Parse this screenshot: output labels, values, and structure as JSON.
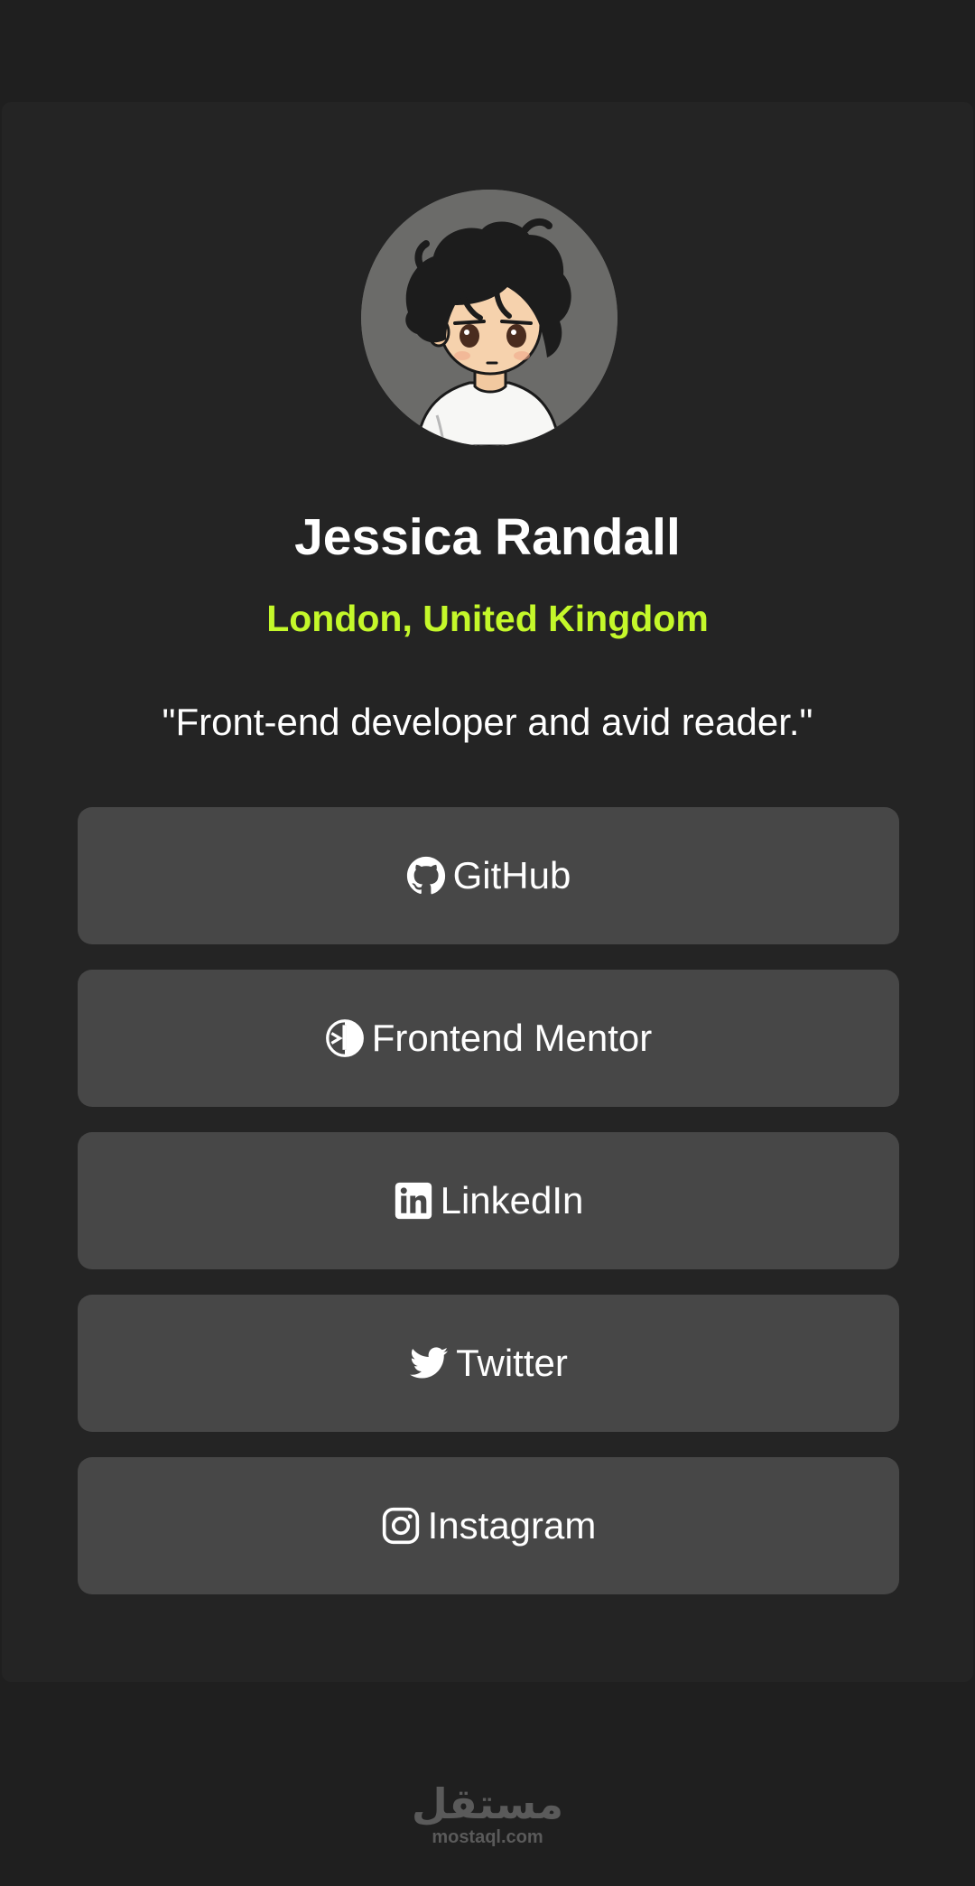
{
  "profile": {
    "name": "Jessica Randall",
    "location": "London, United Kingdom",
    "bio": "\"Front-end developer and avid reader.\""
  },
  "links": [
    {
      "label": "GitHub",
      "icon": "github-icon"
    },
    {
      "label": "Frontend Mentor",
      "icon": "frontend-mentor-icon"
    },
    {
      "label": "LinkedIn",
      "icon": "linkedin-icon"
    },
    {
      "label": "Twitter",
      "icon": "twitter-icon"
    },
    {
      "label": "Instagram",
      "icon": "instagram-icon"
    }
  ],
  "footer": {
    "logo_arabic": "مستقل",
    "logo_latin": "mostaql.com"
  },
  "colors": {
    "page_background": "#1f1f1f",
    "card_background": "#242424",
    "button_background": "#474747",
    "accent": "#c4f82a",
    "text": "#ffffff"
  }
}
